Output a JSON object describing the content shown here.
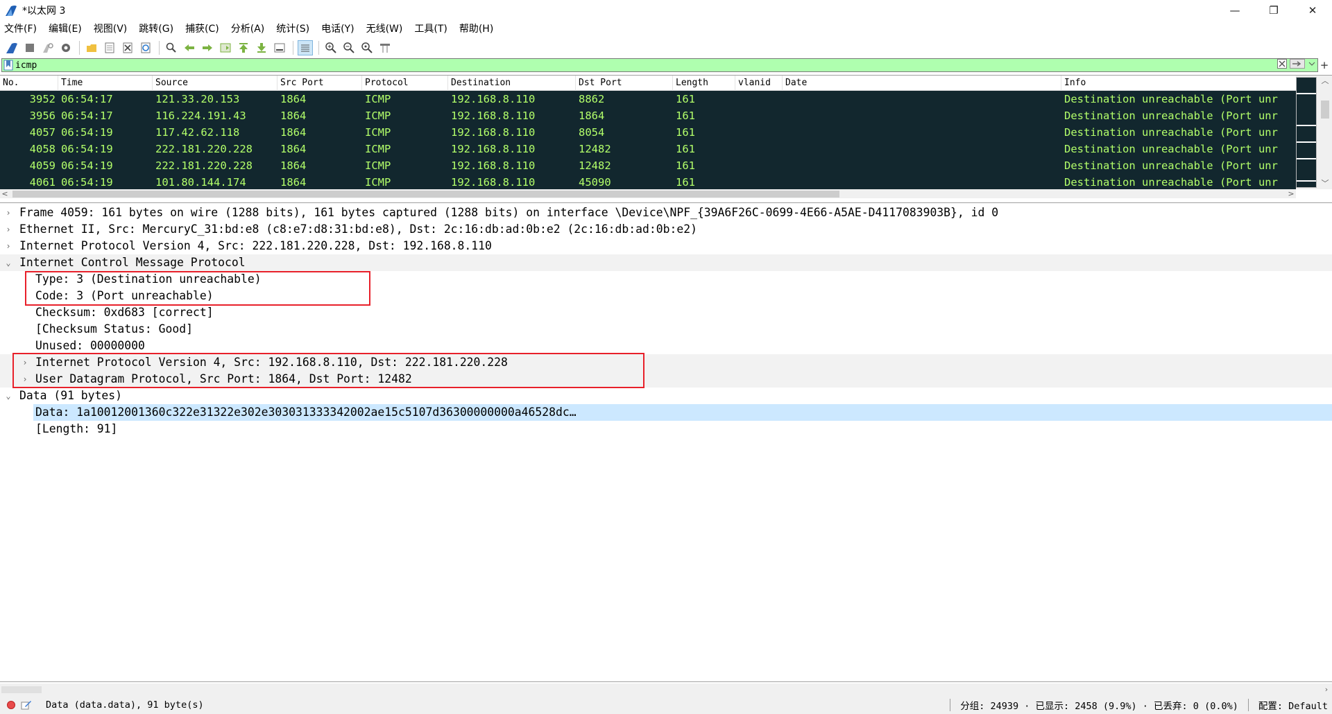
{
  "window": {
    "title": "*以太网 3",
    "controls": [
      "—",
      "❐",
      "✕"
    ]
  },
  "menu": [
    "文件(F)",
    "编辑(E)",
    "视图(V)",
    "跳转(G)",
    "捕获(C)",
    "分析(A)",
    "统计(S)",
    "电话(Y)",
    "无线(W)",
    "工具(T)",
    "帮助(H)"
  ],
  "toolbar": {
    "icons": [
      "shark-fin-start-icon",
      "stop-capture-icon",
      "restart-capture-icon",
      "capture-options-icon",
      "open-file-icon",
      "save-file-icon",
      "close-file-icon",
      "reload-file-icon",
      "find-packet-icon",
      "go-back-icon",
      "go-forward-icon",
      "go-to-packet-icon",
      "go-first-icon",
      "go-last-icon",
      "auto-scroll-icon",
      "colorize-icon",
      "zoom-in-icon",
      "zoom-out-icon",
      "zoom-normal-icon",
      "resize-columns-icon"
    ]
  },
  "filter": {
    "value": "icmp",
    "plus": "+"
  },
  "packet_list": {
    "columns": [
      "No.",
      "Time",
      "Source",
      "Src Port",
      "Protocol",
      "Destination",
      "Dst Port",
      "Length",
      "vlanid",
      "Date",
      "Info"
    ],
    "rows": [
      {
        "no": "3952",
        "time": "06:54:17",
        "source": "121.33.20.153",
        "src_port": "1864",
        "protocol": "ICMP",
        "destination": "192.168.8.110",
        "dst_port": "8862",
        "length": "161",
        "vlanid": "",
        "date": "",
        "info": "Destination unreachable (Port unr"
      },
      {
        "no": "3956",
        "time": "06:54:17",
        "source": "116.224.191.43",
        "src_port": "1864",
        "protocol": "ICMP",
        "destination": "192.168.8.110",
        "dst_port": "1864",
        "length": "161",
        "vlanid": "",
        "date": "",
        "info": "Destination unreachable (Port unr"
      },
      {
        "no": "4057",
        "time": "06:54:19",
        "source": "117.42.62.118",
        "src_port": "1864",
        "protocol": "ICMP",
        "destination": "192.168.8.110",
        "dst_port": "8054",
        "length": "161",
        "vlanid": "",
        "date": "",
        "info": "Destination unreachable (Port unr"
      },
      {
        "no": "4058",
        "time": "06:54:19",
        "source": "222.181.220.228",
        "src_port": "1864",
        "protocol": "ICMP",
        "destination": "192.168.8.110",
        "dst_port": "12482",
        "length": "161",
        "vlanid": "",
        "date": "",
        "info": "Destination unreachable (Port unr"
      },
      {
        "no": "4059",
        "time": "06:54:19",
        "source": "222.181.220.228",
        "src_port": "1864",
        "protocol": "ICMP",
        "destination": "192.168.8.110",
        "dst_port": "12482",
        "length": "161",
        "vlanid": "",
        "date": "",
        "info": "Destination unreachable (Port unr"
      },
      {
        "no": "4061",
        "time": "06:54:19",
        "source": "101.80.144.174",
        "src_port": "1864",
        "protocol": "ICMP",
        "destination": "192.168.8.110",
        "dst_port": "45090",
        "length": "161",
        "vlanid": "",
        "date": "",
        "info": "Destination unreachable (Port unr"
      }
    ]
  },
  "details": {
    "frame": "Frame 4059: 161 bytes on wire (1288 bits), 161 bytes captured (1288 bits) on interface \\Device\\NPF_{39A6F26C-0699-4E66-A5AE-D4117083903B}, id 0",
    "ethernet": "Ethernet II, Src: MercuryC_31:bd:e8 (c8:e7:d8:31:bd:e8), Dst: 2c:16:db:ad:0b:e2 (2c:16:db:ad:0b:e2)",
    "ipv4": "Internet Protocol Version 4, Src: 222.181.220.228, Dst: 192.168.8.110",
    "icmp": "Internet Control Message Protocol",
    "icmp_type": "Type: 3 (Destination unreachable)",
    "icmp_code": "Code: 3 (Port unreachable)",
    "checksum": "Checksum: 0xd683 [correct]",
    "checksum_status": "[Checksum Status: Good]",
    "unused": "Unused: 00000000",
    "inner_ipv4": "Internet Protocol Version 4, Src: 192.168.8.110, Dst: 222.181.220.228",
    "inner_udp": "User Datagram Protocol, Src Port: 1864, Dst Port: 12482",
    "data": "Data (91 bytes)",
    "data_value": "Data: 1a10012001360c322e31322e302e303031333342002ae15c5107d36300000000a46528dc…",
    "data_length": "[Length: 91]"
  },
  "status": {
    "field": "Data (data.data), 91 byte(s)",
    "packets": "分组: 24939 · 已显示: 2458 (9.9%) · 已丢弃: 0 (0.0%)",
    "profile": "配置: Default"
  },
  "colors": {
    "row_bg": "#12272e",
    "row_fg": "#b3ff6a",
    "filter_bg": "#afffaf",
    "selection": "#cce8ff",
    "highlight_box": "#e8202a"
  }
}
